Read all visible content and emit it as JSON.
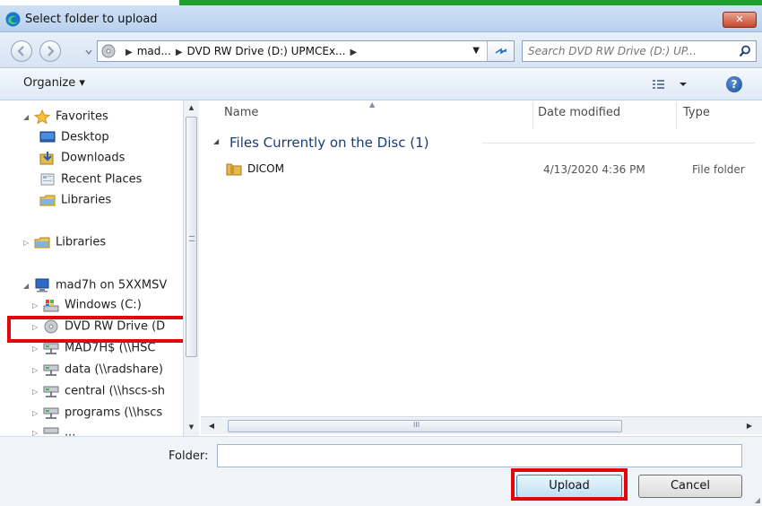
{
  "window": {
    "title": "Select folder to upload",
    "close_glyph": "✕"
  },
  "navigation": {
    "breadcrumbs": [
      "mad...",
      "DVD RW Drive (D:) UPMCEx..."
    ],
    "search_placeholder": "Search DVD RW Drive (D:) UP..."
  },
  "toolbar": {
    "organize_label": "Organize ▾",
    "help_glyph": "?"
  },
  "nav_tree": {
    "favorites_label": "Favorites",
    "favorites_items": [
      "Desktop",
      "Downloads",
      "Recent Places",
      "Libraries"
    ],
    "libraries_label": "Libraries",
    "computer_label": "mad7h on 5XXMSV",
    "drives": [
      "Windows (C:)",
      "DVD RW Drive (D",
      "MAD7H$ (\\\\HSC",
      "data (\\\\radshare)",
      "central (\\\\hscs-sh",
      "programs (\\\\hscs",
      "..."
    ]
  },
  "file_list": {
    "columns": [
      "Name",
      "Date modified",
      "Type"
    ],
    "group_title": "Files Currently on the Disc (1)",
    "rows": [
      {
        "name": "DICOM",
        "date_modified": "4/13/2020 4:36 PM",
        "type": "File folder"
      }
    ]
  },
  "scrollbar": {
    "h_grip": "III"
  },
  "footer": {
    "folder_label": "Folder:",
    "folder_value": "",
    "upload_label": "Upload",
    "cancel_label": "Cancel"
  },
  "highlight_color": "#e3070d",
  "accent_color": "#1f9d2f"
}
